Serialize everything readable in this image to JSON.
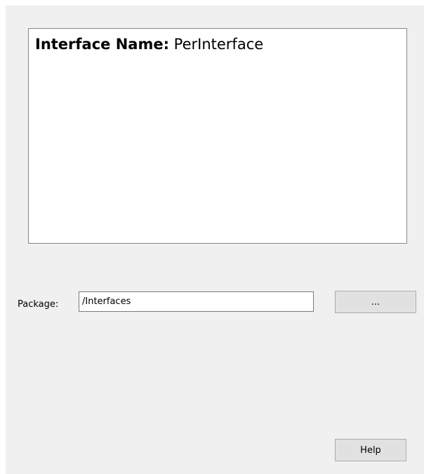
{
  "interface": {
    "name_label": "Interface Name:",
    "name_value": "PerInterface"
  },
  "package": {
    "label": "Package:",
    "value": "/Interfaces",
    "browse_label": "..."
  },
  "footer": {
    "help_label": "Help"
  }
}
